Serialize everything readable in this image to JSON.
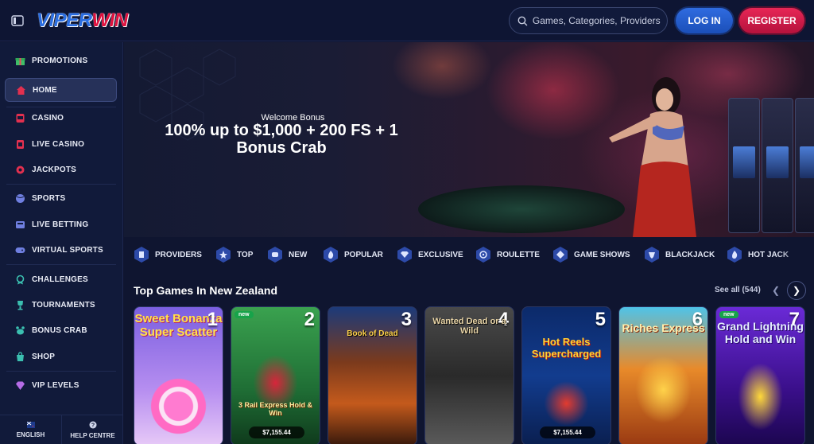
{
  "header": {
    "logo_part1": "VIPER",
    "logo_part2": "WIN",
    "search_placeholder": "Games, Categories, Providers",
    "login_label": "LOG IN",
    "register_label": "REGISTER"
  },
  "sidebar": {
    "items": [
      {
        "label": "PROMOTIONS",
        "icon": "gift-icon"
      },
      {
        "label": "HOME",
        "icon": "home-icon",
        "active": true
      },
      {
        "label": "CASINO",
        "icon": "slot-machine-icon"
      },
      {
        "label": "LIVE CASINO",
        "icon": "cards-icon"
      },
      {
        "label": "JACKPOTS",
        "icon": "jackpot-icon"
      },
      {
        "label": "SPORTS",
        "icon": "ball-icon"
      },
      {
        "label": "LIVE BETTING",
        "icon": "live-betting-icon"
      },
      {
        "label": "VIRTUAL SPORTS",
        "icon": "gamepad-icon"
      },
      {
        "label": "CHALLENGES",
        "icon": "medal-icon"
      },
      {
        "label": "TOURNAMENTS",
        "icon": "trophy-icon"
      },
      {
        "label": "BONUS CRAB",
        "icon": "crab-icon"
      },
      {
        "label": "SHOP",
        "icon": "shop-icon"
      },
      {
        "label": "VIP LEVELS",
        "icon": "diamond-icon"
      }
    ],
    "footer": {
      "language": "ENGLISH",
      "help": "HELP CENTRE"
    }
  },
  "banner": {
    "subtitle": "Welcome Bonus",
    "title": "100% up to $1,000 + 200 FS + 1 Bonus Crab"
  },
  "categories": [
    "PROVIDERS",
    "TOP",
    "NEW",
    "POPULAR",
    "EXCLUSIVE",
    "ROULETTE",
    "GAME SHOWS",
    "BLACKJACK",
    "HOT JACK"
  ],
  "section": {
    "title": "Top Games In New Zealand",
    "see_all": "See all (544)"
  },
  "games": [
    {
      "rank": "1",
      "title": "Sweet Bonanza Super Scatter",
      "tag": "",
      "jackpot": ""
    },
    {
      "rank": "2",
      "title": "3 Rail Express Hold & Win",
      "tag": "new",
      "jackpot": "$7,155.44"
    },
    {
      "rank": "3",
      "title": "Book of Dead",
      "tag": "",
      "jackpot": ""
    },
    {
      "rank": "4",
      "title": "Wanted Dead or a Wild",
      "tag": "",
      "jackpot": ""
    },
    {
      "rank": "5",
      "title": "Hot Reels Supercharged",
      "tag": "",
      "jackpot": "$7,155.44"
    },
    {
      "rank": "6",
      "title": "Riches Express",
      "tag": "",
      "jackpot": ""
    },
    {
      "rank": "7",
      "title": "Grand Lightning Hold and Win",
      "tag": "new",
      "jackpot": ""
    }
  ],
  "colors": {
    "background": "#0f1530",
    "sidebar": "#111a3a",
    "login": "#2f6be0",
    "register": "#e72656"
  }
}
